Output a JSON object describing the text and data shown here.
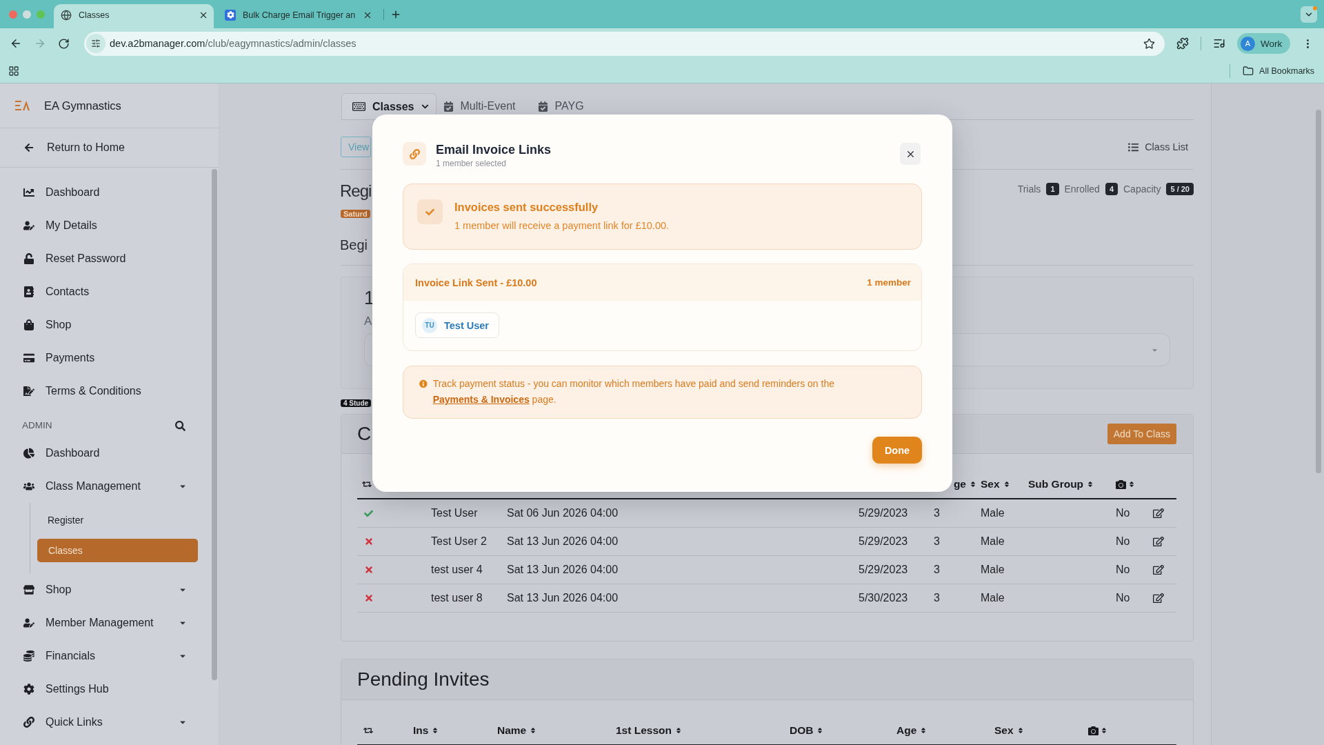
{
  "browser": {
    "tabs": [
      {
        "title": "Classes",
        "selected": true
      },
      {
        "title": "Bulk Charge Email Trigger an",
        "selected": false
      }
    ],
    "url_host": "dev.a2bmanager.com",
    "url_path": "/club/eagymnastics/admin/classes",
    "profile": {
      "initial": "A",
      "label": "Work"
    },
    "bookmarks_label": "All Bookmarks"
  },
  "sidebar": {
    "brand": "EA Gymnastics",
    "back_link": "Return to Home",
    "items": [
      {
        "label": "Dashboard",
        "selected": false
      },
      {
        "label": "My Details",
        "selected": false
      },
      {
        "label": "Reset Password",
        "selected": false
      },
      {
        "label": "Contacts",
        "selected": false
      },
      {
        "label": "Shop",
        "selected": false
      },
      {
        "label": "Payments",
        "selected": false
      },
      {
        "label": "Terms & Conditions",
        "selected": false
      }
    ],
    "admin": {
      "label": "ADMIN",
      "items": [
        {
          "label": "Dashboard",
          "kind": "link",
          "selected": false
        },
        {
          "label": "Class Management",
          "kind": "group",
          "selected": false,
          "children": [
            {
              "label": "Register",
              "selected": false
            },
            {
              "label": "Classes",
              "selected": true
            }
          ]
        },
        {
          "label": "Shop",
          "kind": "group",
          "selected": false
        },
        {
          "label": "Member Management",
          "kind": "group",
          "selected": false
        },
        {
          "label": "Financials",
          "kind": "group",
          "selected": false
        },
        {
          "label": "Settings Hub",
          "kind": "link",
          "selected": false
        },
        {
          "label": "Quick Links",
          "kind": "group",
          "selected": false
        }
      ]
    }
  },
  "page": {
    "tabs": [
      {
        "label": "Classes",
        "kind": "dropdown",
        "selected": true
      },
      {
        "label": "Multi-Event",
        "kind": "link",
        "selected": false
      },
      {
        "label": "PAYG",
        "kind": "link",
        "selected": false
      }
    ],
    "view_button": "View",
    "class_list_link": "Class List",
    "title": "Regi",
    "stats": [
      {
        "label": "Trials",
        "value": "1"
      },
      {
        "label": "Enrolled",
        "value": "4"
      },
      {
        "label": "Capacity",
        "value": "5 / 20"
      }
    ],
    "day_badge": "Saturd",
    "subtitle": "Begi",
    "summary_card": {
      "number": "1",
      "label": "A"
    },
    "students_badge": "4 Stude",
    "class_card": {
      "title": "C",
      "add_button": "Add To Class",
      "columns": [
        "",
        "",
        "",
        "ge",
        "Sex",
        "Sub Group",
        ""
      ],
      "rows": [
        {
          "checked": true,
          "cells": [
            "Test User",
            "Sat 06 Jun 2026 04:00",
            "5/29/2023",
            "3",
            "Male",
            "",
            "No"
          ]
        },
        {
          "checked": false,
          "cells": [
            "Test User 2",
            "Sat 13 Jun 2026 04:00",
            "5/29/2023",
            "3",
            "Male",
            "",
            "No"
          ]
        },
        {
          "checked": false,
          "cells": [
            "test user 4",
            "Sat 13 Jun 2026 04:00",
            "5/29/2023",
            "3",
            "Male",
            "",
            "No"
          ]
        },
        {
          "checked": false,
          "cells": [
            "test user 8",
            "Sat 13 Jun 2026 04:00",
            "5/30/2023",
            "3",
            "Male",
            "",
            "No"
          ]
        }
      ]
    },
    "pending_invites": {
      "title": "Pending Invites",
      "columns": [
        "Ins",
        "Name",
        "1st Lesson",
        "DOB",
        "Age",
        "Sex"
      ]
    }
  },
  "modal": {
    "title": "Email Invoice Links",
    "subtitle": "1 member selected",
    "success": {
      "title": "Invoices sent successfully",
      "message": "1 member will receive a payment link for £10.00."
    },
    "group": {
      "title": "Invoice Link Sent - £10.00",
      "count": "1 member",
      "members": [
        {
          "initials": "TU",
          "name": "Test User"
        }
      ]
    },
    "note": {
      "text": "Track payment status - you can monitor which members have paid and send reminders on the",
      "link": "Payments & Invoices",
      "text_after": "page."
    },
    "done_button": "Done"
  }
}
